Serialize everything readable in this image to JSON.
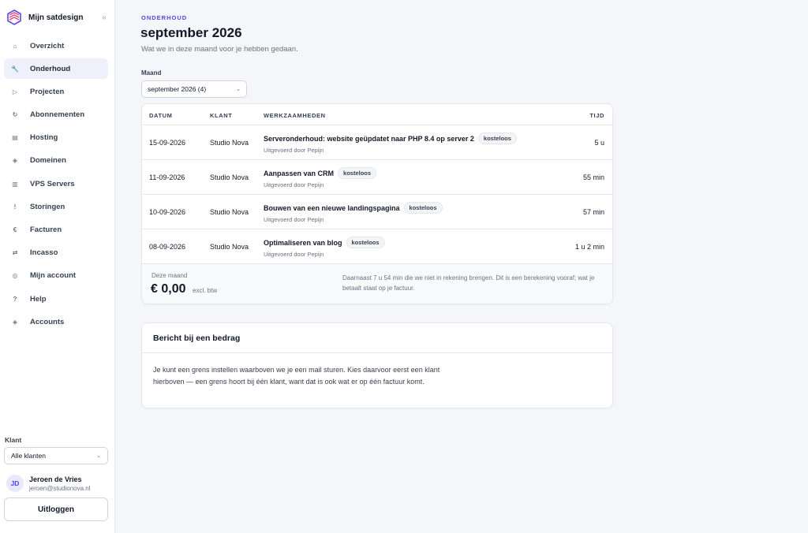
{
  "brand": {
    "name": "Mijn satdesign",
    "collapse_icon": "«"
  },
  "nav": [
    {
      "label": "Overzicht",
      "icon": "⌂",
      "icon_name": "home-icon"
    },
    {
      "label": "Onderhoud",
      "icon": "🔧",
      "icon_name": "wrench-icon",
      "active": true
    },
    {
      "label": "Projecten",
      "icon": "▷",
      "icon_name": "play-icon"
    },
    {
      "label": "Abonnementen",
      "icon": "↻",
      "icon_name": "refresh-icon"
    },
    {
      "label": "Hosting",
      "icon": "▤",
      "icon_name": "server-icon"
    },
    {
      "label": "Domeinen",
      "icon": "◈",
      "icon_name": "globe-icon"
    },
    {
      "label": "VPS Servers",
      "icon": "▥",
      "icon_name": "vps-icon"
    },
    {
      "label": "Storingen",
      "icon": "!",
      "icon_name": "alert-icon"
    },
    {
      "label": "Facturen",
      "icon": "€",
      "icon_name": "euro-icon"
    },
    {
      "label": "Incasso",
      "icon": "⇄",
      "icon_name": "transfer-icon"
    },
    {
      "label": "Mijn account",
      "icon": "◎",
      "icon_name": "account-icon"
    },
    {
      "label": "Help",
      "icon": "?",
      "icon_name": "help-icon"
    },
    {
      "label": "Accounts",
      "icon": "◈",
      "icon_name": "accounts-icon"
    }
  ],
  "client": {
    "label": "Klant",
    "selected": "Alle klanten"
  },
  "user": {
    "initials": "JD",
    "name": "Jeroen de Vries",
    "email": "jeroen@studionova.nl"
  },
  "logout_label": "Uitloggen",
  "header": {
    "eyebrow": "ONDERHOUD",
    "title": "september 2026",
    "subtitle": "Wat we in deze maand voor je hebben gedaan."
  },
  "month": {
    "label": "Maand",
    "selected": "september 2026 (4)"
  },
  "table": {
    "headers": {
      "date": "DATUM",
      "client": "KLANT",
      "tasks": "WERKZAAMHEDEN",
      "time": "TIJD"
    },
    "rows": [
      {
        "date": "15-09-2026",
        "client": "Studio Nova",
        "title": "Serveronderhoud: website geüpdatet naar PHP 8.4 op server 2",
        "badge": "kosteloos",
        "by": "Uitgevoerd door Pepijn",
        "time": "5 u"
      },
      {
        "date": "11-09-2026",
        "client": "Studio Nova",
        "title": "Aanpassen van CRM",
        "badge": "kosteloos",
        "by": "Uitgevoerd door Pepijn",
        "time": "55 min"
      },
      {
        "date": "10-09-2026",
        "client": "Studio Nova",
        "title": "Bouwen van een nieuwe landingspagina",
        "badge": "kosteloos",
        "by": "Uitgevoerd door Pepijn",
        "time": "57 min"
      },
      {
        "date": "08-09-2026",
        "client": "Studio Nova",
        "title": "Optimaliseren van blog",
        "badge": "kosteloos",
        "by": "Uitgevoerd door Pepijn",
        "time": "1 u 2 min"
      }
    ],
    "footer": {
      "label": "Deze maand",
      "amount": "€ 0,00",
      "tax": "excl. btw",
      "note": "Daarnaast 7 u 54 min die we niet in rekening brengen. Dit is een berekening vooraf; wat je betaalt staat op je factuur."
    }
  },
  "message": {
    "title": "Bericht bij een bedrag",
    "body": "Je kunt een grens instellen waarboven we je een mail sturen. Kies daarvoor eerst een klant hierboven — een grens hoort bij één klant, want dat is ook wat er op één factuur komt."
  },
  "colors": {
    "accent": "#4f46e5",
    "active_bg": "#eef0fb"
  }
}
